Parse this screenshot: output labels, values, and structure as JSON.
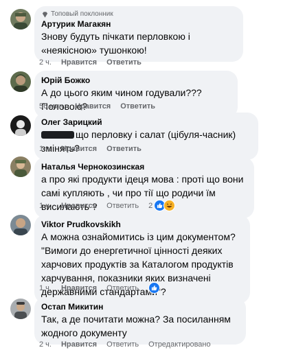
{
  "comments": [
    {
      "badge": "Топовый поклонник",
      "author": "Артурик Магакян",
      "text": "Знову будуть пічкати перловкою і «неякісною» тушонкою!",
      "time": "2 ч.",
      "actions": [
        "Нравится",
        "Ответить"
      ]
    },
    {
      "author": "Юрій Божко",
      "text": "А до цього яким чином годували??? Половою?",
      "time": "56 мин.",
      "actions": [
        "Нравится",
        "Ответить"
      ]
    },
    {
      "author": "Олег Зарицкий",
      "text": "що перловку і салат (цібуля-часник) змінять?",
      "time": "1 ч.",
      "actions": [
        "Нравится",
        "Ответить"
      ]
    },
    {
      "author": "Наталья Чернокозинская",
      "text": "а про які продукти ідеця мова : проті що вони самі купляють , чи про тії що родичи їм висилають ?",
      "time": "1 ч.",
      "actions": [
        "Нравится",
        "Ответить"
      ],
      "reactions": {
        "count": "2",
        "icons": [
          "like-icon",
          "laugh-emoji-icon"
        ]
      }
    },
    {
      "author": "Viktor Prudkovskikh",
      "text": "А можна ознайомитись із цим документом? \"Вимоги до енергетичної цінності деяких харчових продуктів за Каталогом продуктів харчування, показники яких визначені державними стандартами\"?",
      "time": "1 ч.",
      "actions": [
        "Нравится",
        "Ответить"
      ],
      "reactions": {
        "count": "",
        "icons": [
          "like-icon"
        ]
      }
    },
    {
      "author": "Остап Микитин",
      "text": "Так, а де почитати можна? За посиланням жодного документу",
      "time": "2 ч.",
      "actions": [
        "Нравится",
        "Ответить",
        "Отредактировано"
      ]
    }
  ],
  "colors": {
    "bubble": "#f0f2f5",
    "meta_text": "#65676b",
    "like_blue": "#1877f2"
  }
}
